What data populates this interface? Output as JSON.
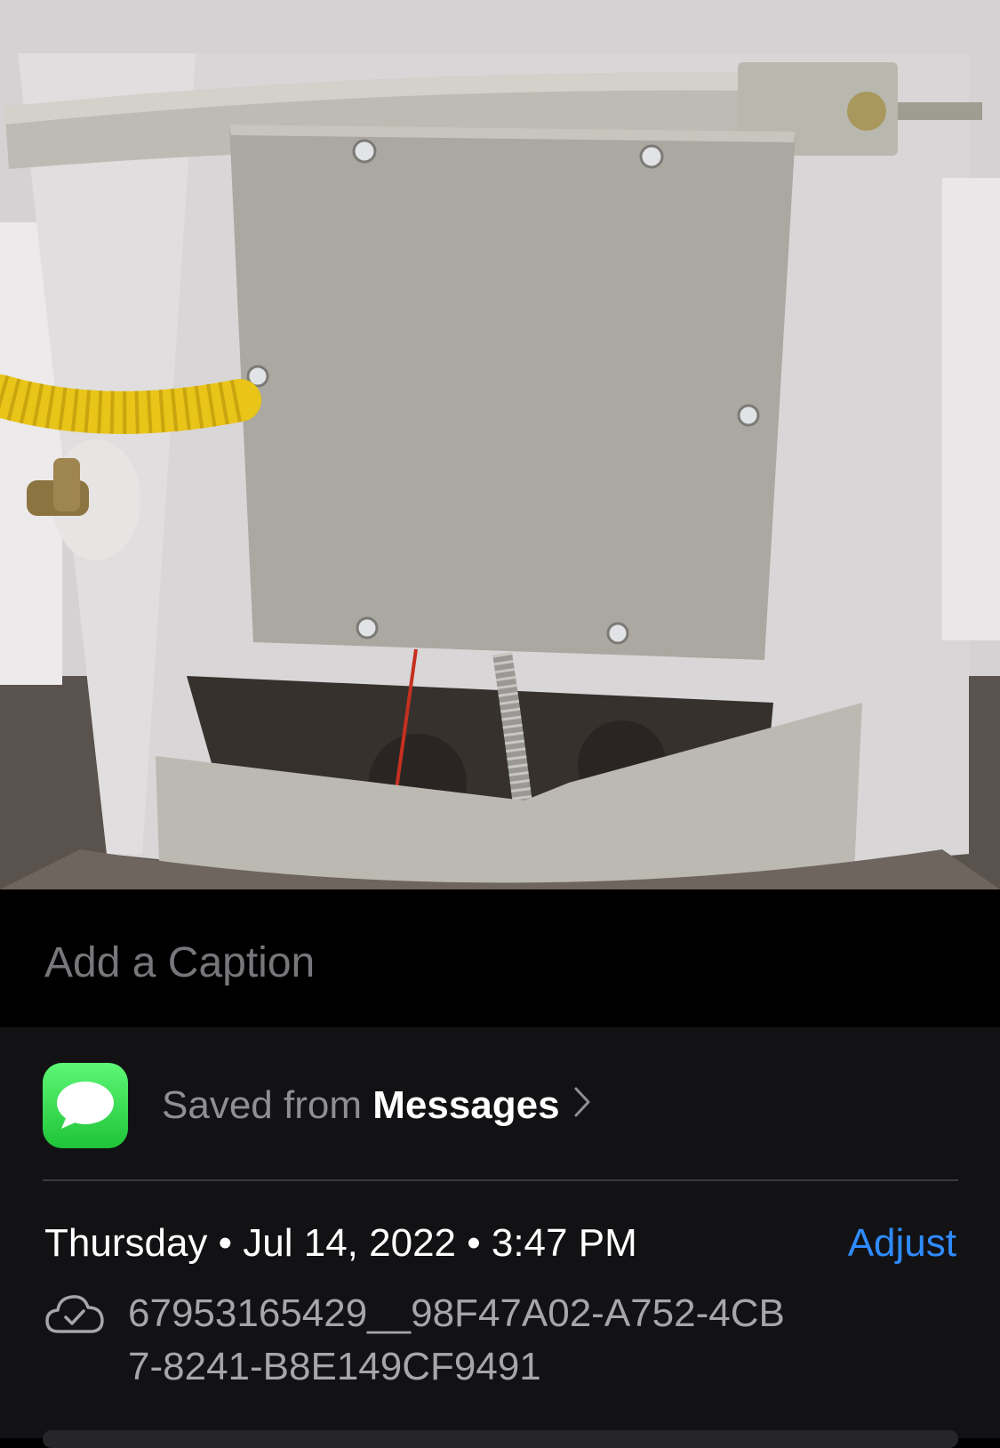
{
  "photo": {
    "description_icon": "water-heater-photo"
  },
  "caption": {
    "placeholder": "Add a Caption",
    "value": ""
  },
  "source": {
    "prefix": "Saved from",
    "app": "Messages",
    "icon": "messages-app-icon",
    "chevron": "chevron-right-icon"
  },
  "details": {
    "date_line": "Thursday • Jul 14, 2022 • 3:47 PM",
    "adjust_label": "Adjust",
    "file_name": "67953165429__98F47A02-A752-4CB7-8241-B8E149CF9491",
    "file_icon": "icloud-checkmark-icon"
  },
  "colors": {
    "accent": "#2f8bff",
    "messages_green": "#2bd347",
    "panel_bg": "#121215",
    "secondary_text": "#8e8e93"
  }
}
